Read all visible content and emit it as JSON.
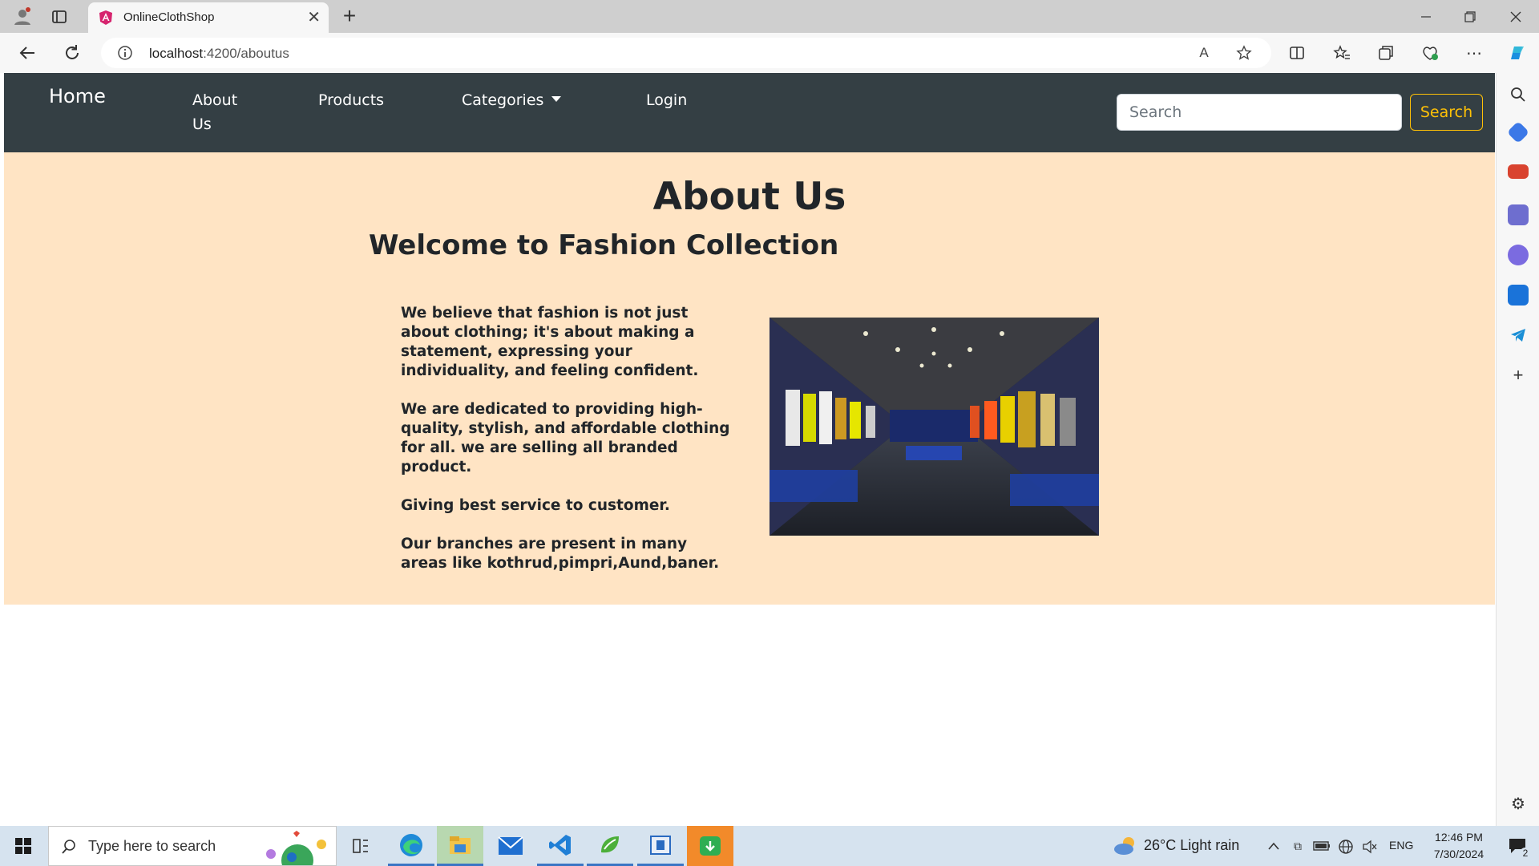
{
  "browser": {
    "tab_title": "OnlineClothShop",
    "url_host": "localhost",
    "url_path": ":4200/aboutus",
    "tab_close_symbol": "✕",
    "new_tab_symbol": "+"
  },
  "navbar": {
    "brand": "Home",
    "about": "About Us",
    "products": "Products",
    "categories": "Categories",
    "login": "Login",
    "search_placeholder": "Search",
    "search_button": "Search",
    "colors": {
      "background": "#343f44",
      "search_accent": "#ffc107"
    }
  },
  "about": {
    "title": "About Us",
    "welcome": "Welcome to Fashion Collection",
    "paragraphs": [
      "We believe that fashion is not just about clothing; it's about making a statement, expressing your individuality, and feeling confident.",
      "We are dedicated to providing high-quality, stylish, and affordable clothing for all. we are selling all branded product.",
      "Giving best service to customer.",
      "Our branches are present in many areas like kothrud,pimpri,Aund,baner."
    ],
    "background_color": "#ffe4c4"
  },
  "taskbar": {
    "search_placeholder": "Type here to search",
    "weather": "26°C  Light rain",
    "language": "ENG",
    "time": "12:46 PM",
    "date": "7/30/2024",
    "notification_count": "2"
  }
}
